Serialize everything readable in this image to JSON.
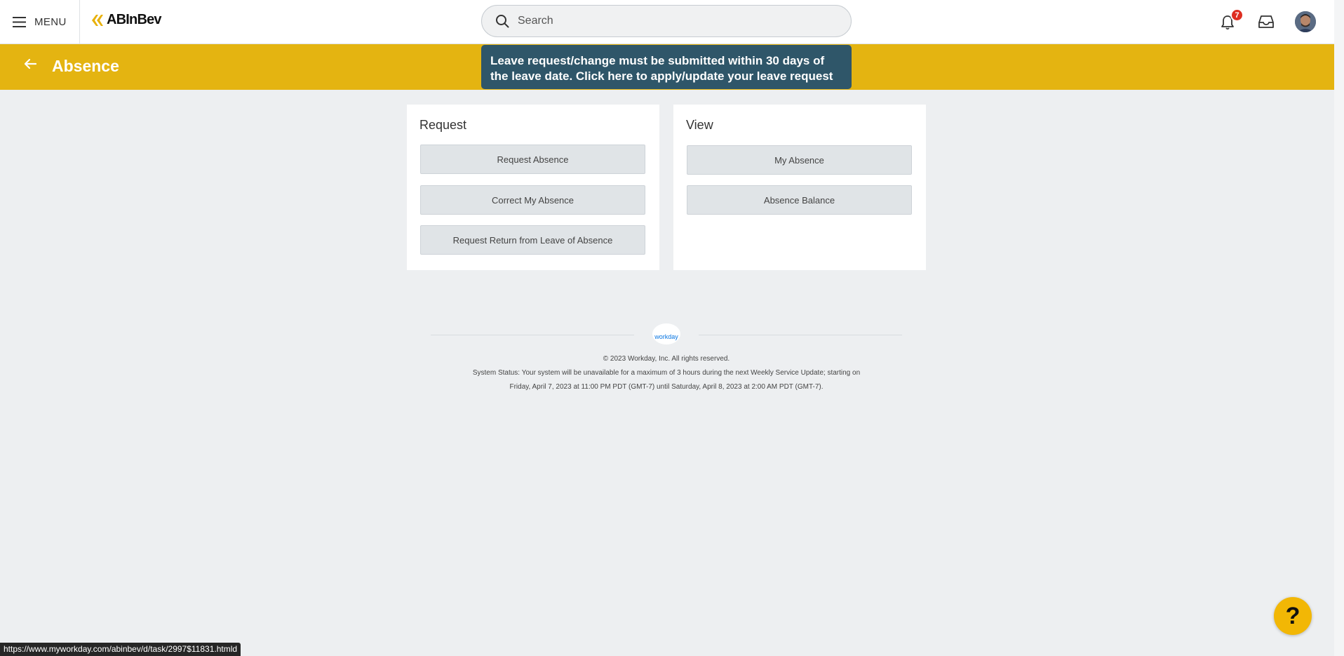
{
  "topbar": {
    "menu_label": "MENU",
    "brand": "ABInBev",
    "search_placeholder": "Search",
    "notification_count": "7"
  },
  "header": {
    "title": "Absence",
    "announcement": "Leave request/change must be submitted within 30 days of the leave date. Click here to apply/update your leave request"
  },
  "cards": {
    "request": {
      "title": "Request",
      "buttons": [
        "Request Absence",
        "Correct My Absence",
        "Request Return from Leave of Absence"
      ]
    },
    "view": {
      "title": "View",
      "buttons": [
        "My Absence",
        "Absence Balance"
      ]
    }
  },
  "footer": {
    "logo_text": "workday",
    "copyright": "© 2023 Workday, Inc. All rights reserved.",
    "status_line1": "System Status: Your system will be unavailable for a maximum of 3 hours during the next Weekly Service Update; starting on",
    "status_line2": "Friday, April 7, 2023 at 11:00 PM PDT (GMT-7) until Saturday, April 8, 2023 at 2:00 AM PDT (GMT-7)."
  },
  "help_label": "?",
  "status_url": "https://www.myworkday.com/abinbev/d/task/2997$11831.htmld",
  "colors": {
    "header_bg": "#e4b411",
    "announcement_bg": "#2f5669",
    "badge": "#de2e21",
    "help_button": "#f2b705"
  }
}
